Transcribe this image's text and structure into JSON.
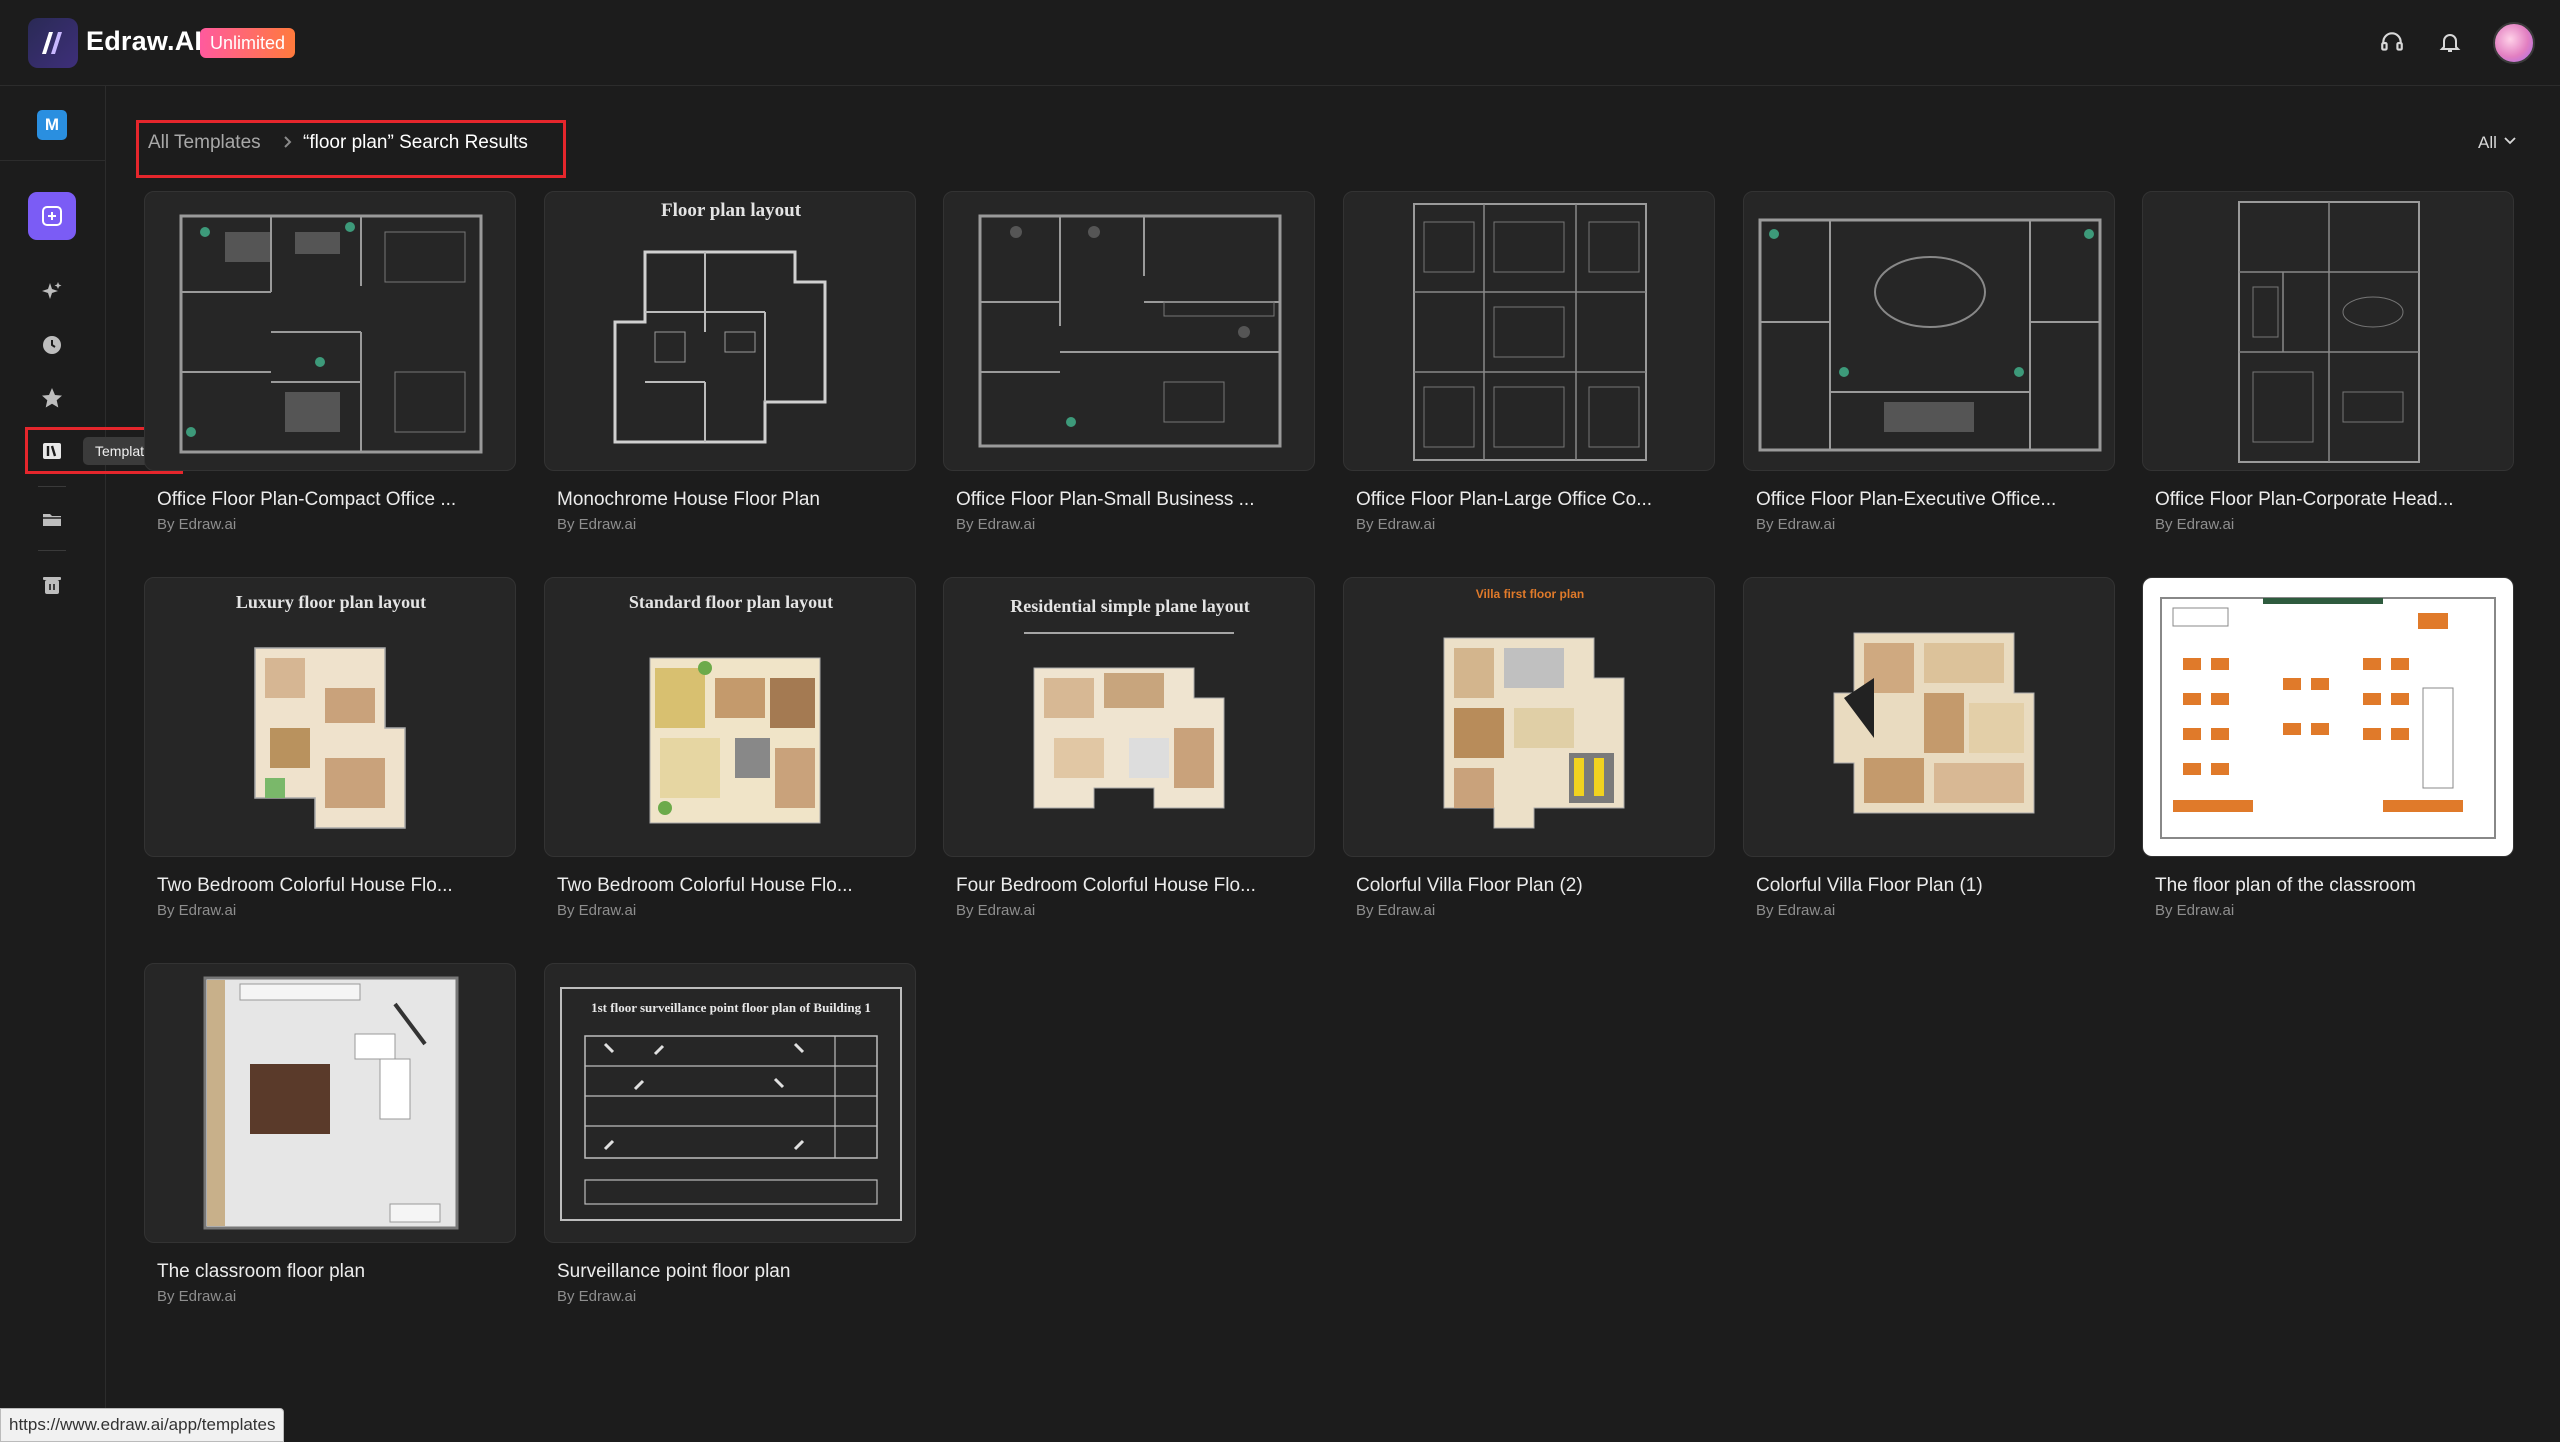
{
  "app": {
    "brand": "Edraw.AI",
    "plan_badge": "Unlimited",
    "workspace_initial": "M"
  },
  "header_icons": [
    "headset-icon",
    "bell-icon",
    "avatar"
  ],
  "sidebar": {
    "items": [
      {
        "name": "new",
        "icon": "plus-square-icon"
      },
      {
        "name": "ai",
        "icon": "sparkle-icon"
      },
      {
        "name": "recent",
        "icon": "clock-icon"
      },
      {
        "name": "favorites",
        "icon": "star-icon"
      },
      {
        "name": "templates",
        "icon": "book-icon"
      },
      {
        "name": "files",
        "icon": "folder-icon"
      },
      {
        "name": "trash",
        "icon": "trash-icon"
      }
    ],
    "tooltip": "Templates"
  },
  "breadcrumb": {
    "root": "All Templates",
    "current": "“floor plan” Search Results"
  },
  "filter": {
    "selected": "All"
  },
  "templates": [
    {
      "title": "Office Floor Plan-Compact Office ...",
      "author": "By Edraw.ai",
      "thumb_heading": ""
    },
    {
      "title": "Monochrome House Floor Plan",
      "author": "By Edraw.ai",
      "thumb_heading": "Floor plan layout"
    },
    {
      "title": "Office Floor Plan-Small Business ...",
      "author": "By Edraw.ai",
      "thumb_heading": ""
    },
    {
      "title": "Office Floor Plan-Large Office Co...",
      "author": "By Edraw.ai",
      "thumb_heading": ""
    },
    {
      "title": "Office Floor Plan-Executive Office...",
      "author": "By Edraw.ai",
      "thumb_heading": ""
    },
    {
      "title": "Office Floor Plan-Corporate Head...",
      "author": "By Edraw.ai",
      "thumb_heading": ""
    },
    {
      "title": "Two Bedroom Colorful House Flo...",
      "author": "By Edraw.ai",
      "thumb_heading": "Luxury floor plan layout"
    },
    {
      "title": "Two Bedroom Colorful House Flo...",
      "author": "By Edraw.ai",
      "thumb_heading": "Standard floor plan layout"
    },
    {
      "title": "Four Bedroom Colorful House Flo...",
      "author": "By Edraw.ai",
      "thumb_heading": "Residential simple plane layout"
    },
    {
      "title": "Colorful Villa Floor Plan (2)",
      "author": "By Edraw.ai",
      "thumb_heading": "Villa first floor plan"
    },
    {
      "title": "Colorful Villa Floor Plan (1)",
      "author": "By Edraw.ai",
      "thumb_heading": ""
    },
    {
      "title": "The floor plan of the classroom",
      "author": "By Edraw.ai",
      "thumb_heading": ""
    },
    {
      "title": "The classroom floor plan",
      "author": "By Edraw.ai",
      "thumb_heading": ""
    },
    {
      "title": "Surveillance point floor plan",
      "author": "By Edraw.ai",
      "thumb_heading": "1st floor surveillance point floor plan of Building 1"
    }
  ],
  "status_bar": {
    "url": "https://www.edraw.ai/app/templates"
  },
  "colors": {
    "accent": "#7b5cf5",
    "highlight_box": "#e5262c",
    "background": "#1c1c1c"
  }
}
